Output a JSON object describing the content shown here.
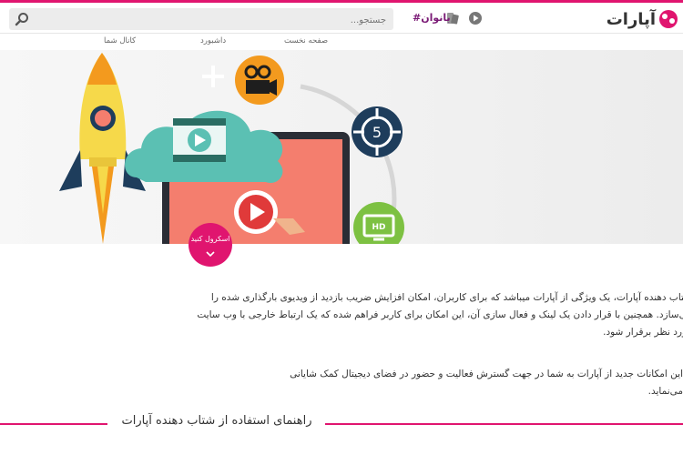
{
  "header": {
    "logo_text": "آپارات",
    "hashtag": "#بانوان",
    "search_placeholder": "جستجو..."
  },
  "nav": [
    "صفحه نخست",
    "داشبورد",
    "کانال شما"
  ],
  "hero": {
    "scroll_label": "اسکرول کنید",
    "hd_badge": "HD",
    "target_number": "5"
  },
  "content": {
    "paragraph_1_line_1": "شتاب دهنده آپارات، یک ویژگی از آپارات میباشد که برای کاربران، امکان افزایش ضریب بازدید از ویدیوی بارگذاری شده را",
    "paragraph_1_line_2": "می‌سازد. همچنین با قرار دادن یک لینک و فعال سازی آن، این امکان برای کاربر فراهم شده که یک ارتباط خارجی با وب سایت",
    "paragraph_1_line_3": "مورد نظر برقرار شود.",
    "paragraph_2": "این امکانات جدید از آپارات به شما در جهت گسترش فعالیت و حضور در فضای دیجیتال کمک شایانی می‌نماید."
  },
  "guide_title": "راهنمای استفاده از شتاب دهنده آپارات",
  "colors": {
    "brand": "#e0156f",
    "orange": "#f39a1e",
    "teal": "#5bc0b3",
    "navy": "#1e3d5c",
    "salmon": "#f47e6e"
  }
}
